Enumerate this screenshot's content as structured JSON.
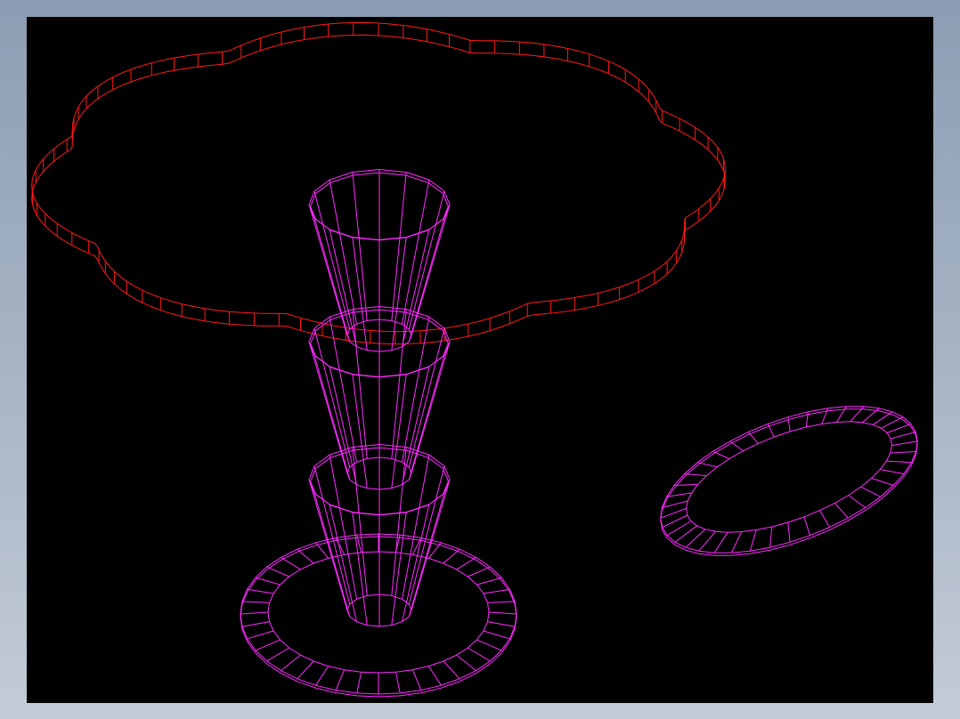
{
  "window": {
    "frame_color": "#98a6b9",
    "viewport_background": "#000000"
  },
  "scene": {
    "objects": [
      {
        "name": "flower-shaped-ring",
        "shape": "8-lobed scalloped slab",
        "color": "#ff1a1a"
      },
      {
        "name": "tapered-cup-upper",
        "shape": "truncated cone",
        "color": "#ff2bff"
      },
      {
        "name": "tapered-cup-middle",
        "shape": "truncated cone",
        "color": "#ff2bff"
      },
      {
        "name": "tapered-cup-lower",
        "shape": "truncated cone",
        "color": "#ff2bff"
      },
      {
        "name": "base-annulus",
        "shape": "flat ring",
        "color": "#ff2bff"
      },
      {
        "name": "tilted-annulus",
        "shape": "flat ring",
        "color": "#ff2bff"
      }
    ]
  }
}
